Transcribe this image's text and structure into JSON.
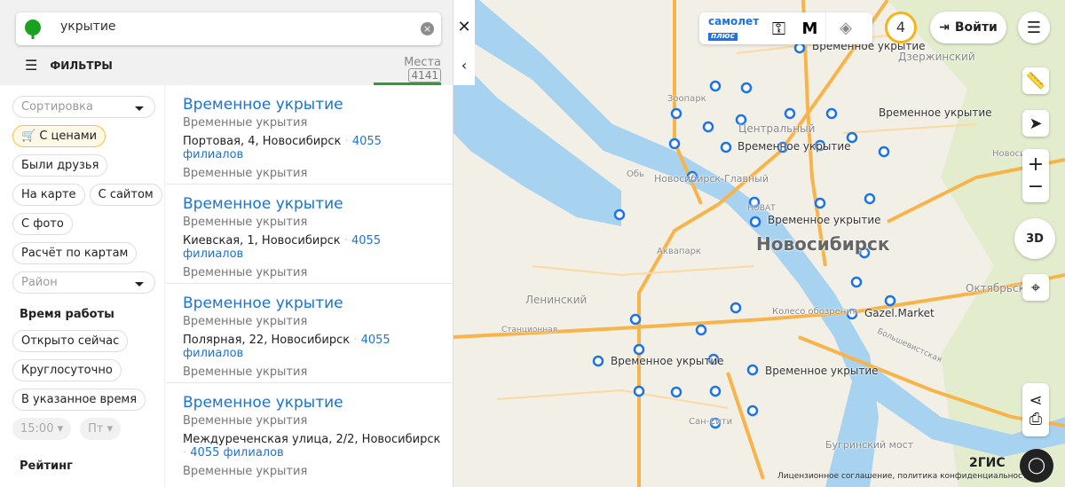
{
  "search": {
    "value": "укрытие"
  },
  "filters_label": "ФИЛЬТРЫ",
  "tab": {
    "label": "Места",
    "count": "4141"
  },
  "filters": {
    "sort": "Сортировка",
    "chips": [
      "С ценами",
      "Были друзья",
      "На карте",
      "С сайтом",
      "С фото",
      "Расчёт по картам"
    ],
    "region": "Район",
    "hours_title": "Время работы",
    "hours": [
      "Открыто сейчас",
      "Круглосуточно",
      "В указанное время"
    ],
    "time": "15:00",
    "day": "Пт",
    "rating_title": "Рейтинг"
  },
  "results": [
    {
      "title": "Временное укрытие",
      "category": "Временные укрытия",
      "address": "Портовая, 4, Новосибирск",
      "branches": "4055 филиалов",
      "rubric": "Временные укрытия"
    },
    {
      "title": "Временное укрытие",
      "category": "Временные укрытия",
      "address": "Киевская, 1, Новосибирск",
      "branches": "4055 филиалов",
      "rubric": "Временные укрытия"
    },
    {
      "title": "Временное укрытие",
      "category": "Временные укрытия",
      "address": "Полярная, 22, Новосибирск",
      "branches": "4055 филиалов",
      "rubric": "Временные укрытия"
    },
    {
      "title": "Временное укрытие",
      "category": "Временные укрытия",
      "address": "Междуреченская улица, 2/2, Новосибирск",
      "branches": "4055 филиалов",
      "rubric": "Временные укрытия"
    }
  ],
  "map": {
    "promo_top": "самолет",
    "promo_bottom": "плюс",
    "notifications": "4",
    "login": "Войти",
    "view_3d": "3D",
    "brand": "2ГИС",
    "footer": "Лицензионное соглашение, политика конфиденциальности",
    "labels": {
      "shelter": "Временное укрытие",
      "dzer": "Дзержинский",
      "central": "Центральный",
      "zoo": "Зоопарк",
      "city": "Новосибирск",
      "station": "Новосибирск-Главный",
      "aqua": "Аквапарк",
      "lenin": "Ленинский",
      "wheel": "Колесо обозрения",
      "gazel": "Gazel.Market",
      "okt": "Октябрьский",
      "bridge": "Бугринский мост",
      "sancity": "Сан-Сити",
      "ob": "Обь",
      "novat": "НОВАТ",
      "bus": "Новосиби",
      "stanc": "Станционная",
      "bolsh": "Большевистская"
    }
  }
}
